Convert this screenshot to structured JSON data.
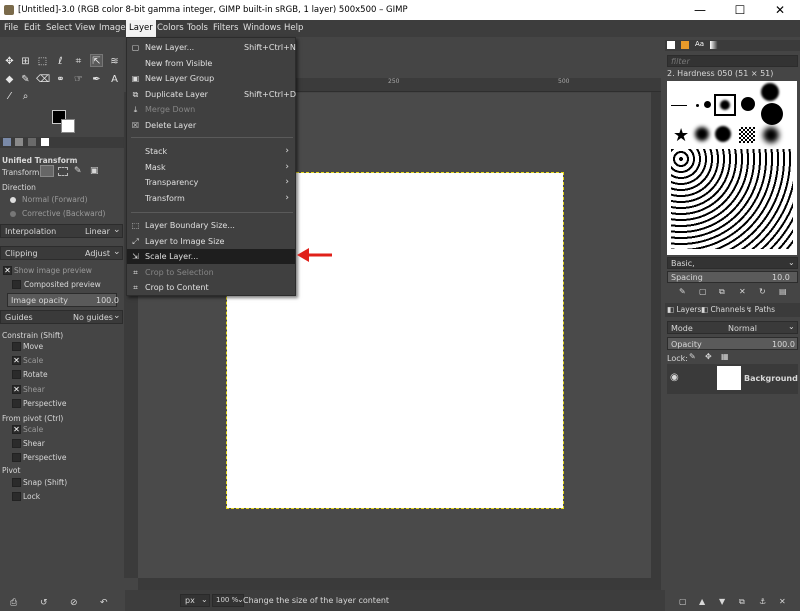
{
  "window": {
    "title": "[Untitled]-3.0 (RGB color 8-bit gamma integer, GIMP built-in sRGB, 1 layer) 500x500 – GIMP",
    "minimize": "—",
    "maximize": "☐",
    "close": "✕"
  },
  "menubar": [
    "File",
    "Edit",
    "Select",
    "View",
    "Image",
    "Layer",
    "Colors",
    "Tools",
    "Filters",
    "Windows",
    "Help"
  ],
  "layer_menu": {
    "items": [
      {
        "label": "New Layer...",
        "shortcut": "Shift+Ctrl+N",
        "icon": "new-layer-icon"
      },
      {
        "label": "New from Visible",
        "shortcut": "",
        "icon": ""
      },
      {
        "label": "New Layer Group",
        "shortcut": "",
        "icon": "layer-group-icon"
      },
      {
        "label": "Duplicate Layer",
        "shortcut": "Shift+Ctrl+D",
        "icon": "duplicate-icon"
      },
      {
        "label": "Merge Down",
        "shortcut": "",
        "icon": "merge-down-icon",
        "disabled": true
      },
      {
        "label": "Delete Layer",
        "shortcut": "",
        "icon": "delete-icon"
      }
    ],
    "submenus": [
      "Stack",
      "Mask",
      "Transparency",
      "Transform"
    ],
    "bottom_items": [
      {
        "label": "Layer Boundary Size...",
        "icon": "boundary-icon"
      },
      {
        "label": "Layer to Image Size",
        "icon": "layer-to-image-icon"
      },
      {
        "label": "Scale Layer...",
        "icon": "scale-layer-icon",
        "highlighted": true
      },
      {
        "label": "Crop to Selection",
        "icon": "crop-icon",
        "disabled": true
      },
      {
        "label": "Crop to Content",
        "icon": "crop-content-icon"
      }
    ]
  },
  "tool_options": {
    "title": "Unified Transform",
    "transform_label": "Transform:",
    "direction_label": "Direction",
    "direction_normal": "Normal (Forward)",
    "direction_corrective": "Corrective (Backward)",
    "interpolation_label": "Interpolation",
    "interpolation_value": "Linear",
    "clipping_label": "Clipping",
    "clipping_value": "Adjust",
    "show_preview": "Show image preview",
    "composited_preview": "Composited preview",
    "image_opacity_label": "Image opacity",
    "image_opacity_value": "100.0",
    "guides_label": "Guides",
    "guides_value": "No guides",
    "constrain_label": "Constrain (Shift)",
    "constrain_items": [
      "Move",
      "Scale",
      "Rotate",
      "Shear",
      "Perspective"
    ],
    "constrain_checked": [
      false,
      true,
      false,
      true,
      false
    ],
    "pivot_from_label": "From pivot  (Ctrl)",
    "pivot_from_items": [
      "Scale",
      "Shear",
      "Perspective"
    ],
    "pivot_from_checked": [
      true,
      false,
      false
    ],
    "pivot_label": "Pivot",
    "pivot_items": [
      "Snap (Shift)",
      "Lock"
    ]
  },
  "brushes": {
    "filter_placeholder": "filter",
    "current_brush": "2. Hardness 050 (51 × 51)",
    "tag_value": "Basic,",
    "spacing_label": "Spacing",
    "spacing_value": "10.0"
  },
  "layers": {
    "tabs": [
      "Layers",
      "Channels",
      "Paths"
    ],
    "mode_label": "Mode",
    "mode_value": "Normal",
    "opacity_label": "Opacity",
    "opacity_value": "100.0",
    "lock_label": "Lock:",
    "layer_name": "Background"
  },
  "statusbar": {
    "unit": "px",
    "zoom": "100 %",
    "message": "Change the size of the layer content"
  },
  "ruler_labels": [
    "0",
    "250",
    "500"
  ],
  "colors": {
    "highlight": "#1e1e1e",
    "arrow": "#e0201a",
    "selection_border": "#e5d81b"
  }
}
